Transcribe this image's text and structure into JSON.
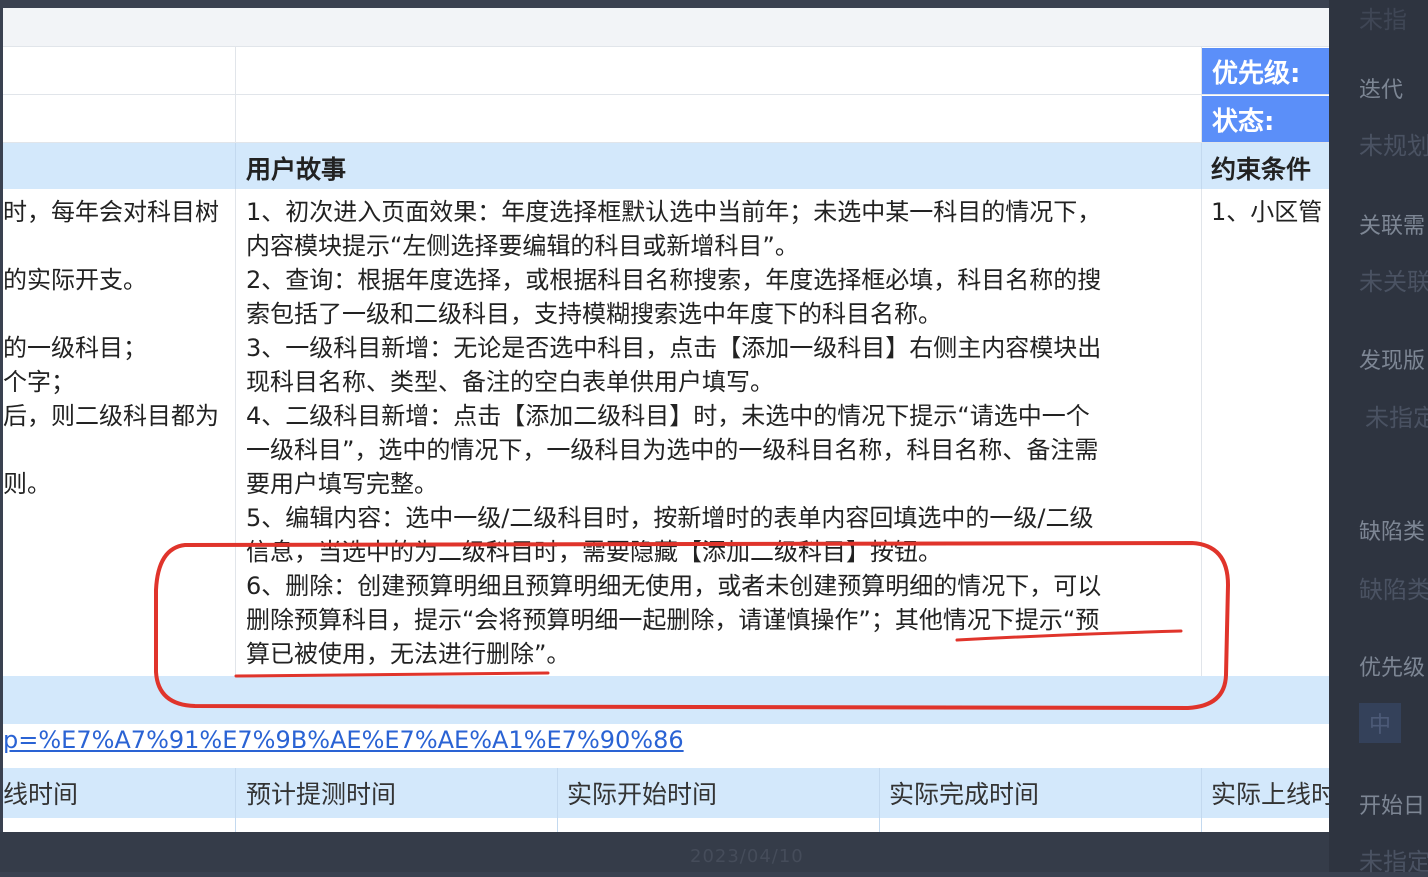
{
  "table": {
    "priority_label": "优先级:",
    "status_label": "状态:",
    "header_story": "用户故事",
    "header_constraint": "约束条件",
    "left_col_lines": [
      "时，每年会对科目树",
      "",
      "的实际开支。",
      "",
      "的一级科目；",
      "个字；",
      "后，则二级科目都为",
      "",
      "则。"
    ],
    "story_lines": [
      "1、初次进入页面效果：年度选择框默认选中当前年；未选中某一科目的情况下，",
      "内容模块提示“左侧选择要编辑的科目或新增科目”。",
      "2、查询：根据年度选择，或根据科目名称搜索，年度选择框必填，科目名称的搜",
      "索包括了一级和二级科目，支持模糊搜索选中年度下的科目名称。",
      "3、一级科目新增：无论是否选中科目，点击【添加一级科目】右侧主内容模块出",
      "现科目名称、类型、备注的空白表单供用户填写。",
      "4、二级科目新增：点击【添加二级科目】时，未选中的情况下提示“请选中一个",
      "一级科目”，选中的情况下，一级科目为选中的一级科目名称，科目名称、备注需",
      "要用户填写完整。",
      "5、编辑内容：选中一级/二级科目时，按新增时的表单内容回填选中的一级/二级",
      "信息，当选中的为二级科目时，需要隐藏【添加二级科目】按钮。",
      "6、删除：创建预算明细且预算明细无使用，或者未创建预算明细的情况下，可以",
      "删除预算科目，提示“会将预算明细一起删除，请谨慎操作”；其他情况下提示“预",
      "算已被使用，无法进行删除”。"
    ],
    "constraint_text": "1、小区管",
    "link_text": "p=%E7%A7%91%E7%9B%AE%E7%AE%A1%E7%90%86",
    "time_headers": [
      "线时间",
      "预计提测时间",
      "实际开始时间",
      "实际完成时间",
      "实际上线时"
    ]
  },
  "sidebar": {
    "top_faded": "未指",
    "items": [
      {
        "label": "迭代",
        "value": "未规划"
      },
      {
        "label": "关联需",
        "value": "未关联"
      },
      {
        "label": "发现版",
        "value": "未指定"
      },
      {
        "label": "缺陷类",
        "value": "缺陷类"
      },
      {
        "label": "优先级",
        "value": "中"
      },
      {
        "label": "开始日",
        "value": "未指定"
      }
    ]
  },
  "bottom": {
    "ghost_text": "2023/04/10"
  },
  "colors": {
    "header_blue": "#d3e8fb",
    "priority_blue": "#5b8ff9",
    "annotation_red": "#e0342b",
    "link_blue": "#2a63d4"
  }
}
